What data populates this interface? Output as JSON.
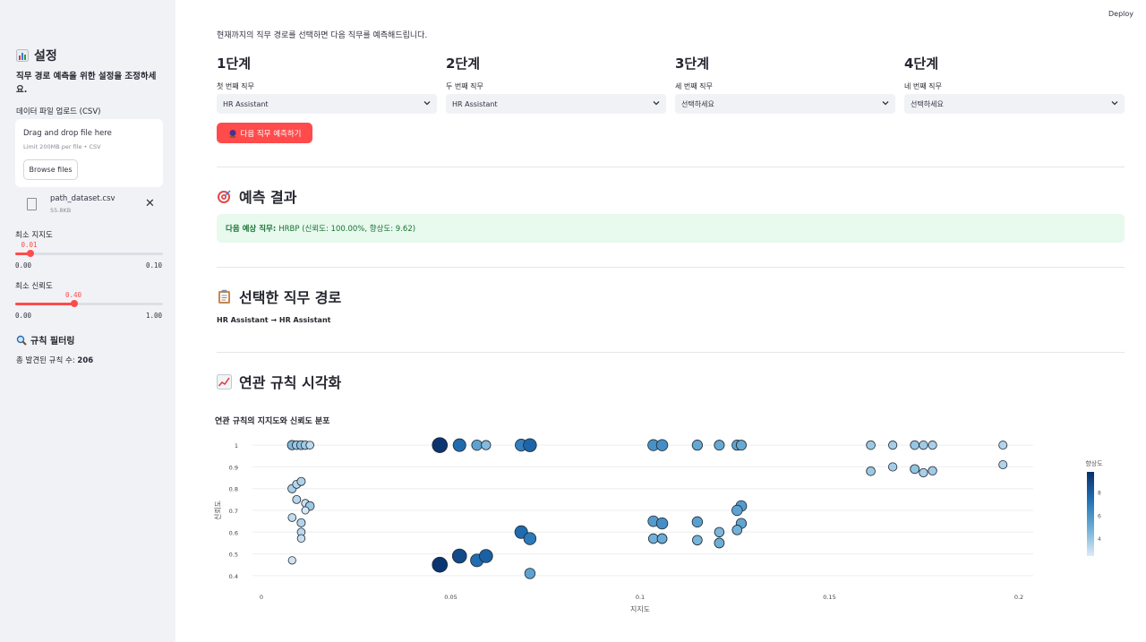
{
  "topbar": {
    "deploy_label": "Deploy"
  },
  "sidebar": {
    "title": "설정",
    "description": "직무 경로 예측을 위한 설정을 조정하세요.",
    "upload": {
      "label": "데이터 파일 업로드 (CSV)",
      "drop_title": "Drag and drop file here",
      "drop_sub": "Limit 200MB per file • CSV",
      "browse_label": "Browse files",
      "file_name": "path_dataset.csv",
      "file_size": "55.8KB"
    },
    "min_support": {
      "label": "최소 지지도",
      "value": "0.01",
      "value_num": 0.01,
      "min": "0.00",
      "max": "0.10",
      "min_num": 0.0,
      "max_num": 0.1
    },
    "min_confidence": {
      "label": "최소 신뢰도",
      "value": "0.40",
      "value_num": 0.4,
      "min": "0.00",
      "max": "1.00",
      "min_num": 0.0,
      "max_num": 1.0
    },
    "filter_title": "규칙 필터링",
    "rule_count_label": "총 발견된 규칙 수:",
    "rule_count": "206"
  },
  "main": {
    "intro": "현재까지의 직무 경로를 선택하면 다음 직무를 예측해드립니다.",
    "steps": [
      {
        "heading": "1단계",
        "label": "첫 번째 직무",
        "value": "HR Assistant"
      },
      {
        "heading": "2단계",
        "label": "두 번째 직무",
        "value": "HR Assistant"
      },
      {
        "heading": "3단계",
        "label": "세 번째 직무",
        "value": "선택하세요"
      },
      {
        "heading": "4단계",
        "label": "네 번째 직무",
        "value": "선택하세요"
      }
    ],
    "predict_button": "다음 직무 예측하기",
    "result_heading": "예측 결과",
    "result_label": "다음 예상 직무:",
    "result_text": "HRBP (신뢰도: 100.00%, 향상도: 9.62)",
    "path_heading": "선택한 직무 경로",
    "path_text": "HR Assistant → HR Assistant",
    "viz_heading": "연관 규칙 시각화"
  },
  "colors": {
    "accent": "#ff4b4b",
    "success_bg": "#e8f9ee",
    "success_text": "#177233",
    "sidebar_bg": "#f0f2f6"
  },
  "chart_data": {
    "type": "scatter",
    "title": "연관 규칙의 지지도와 신뢰도 분포",
    "xlabel": "지지도",
    "ylabel": "신뢰도",
    "colorbar_label": "향상도",
    "xlim": [
      0,
      0.2
    ],
    "ylim": [
      0.35,
      1.05
    ],
    "xticks": [
      0,
      0.05,
      0.1,
      0.15,
      0.2
    ],
    "yticks": [
      0.4,
      0.5,
      0.6,
      0.7,
      0.8,
      0.9,
      1
    ],
    "colorbar_ticks": [
      4,
      6,
      8
    ],
    "colorscale_range": [
      2.5,
      9.8
    ],
    "points": [
      {
        "x": 0.0081,
        "y": 1.0,
        "lift": 4.5
      },
      {
        "x": 0.0093,
        "y": 1.0,
        "lift": 4.0
      },
      {
        "x": 0.0105,
        "y": 1.0,
        "lift": 4.2
      },
      {
        "x": 0.0116,
        "y": 1.0,
        "lift": 3.8
      },
      {
        "x": 0.0128,
        "y": 1.0,
        "lift": 3.2
      },
      {
        "x": 0.0081,
        "y": 0.8,
        "lift": 3.6
      },
      {
        "x": 0.0093,
        "y": 0.82,
        "lift": 3.3
      },
      {
        "x": 0.0105,
        "y": 0.833,
        "lift": 3.5
      },
      {
        "x": 0.0093,
        "y": 0.75,
        "lift": 3.3
      },
      {
        "x": 0.0116,
        "y": 0.733,
        "lift": 3.0
      },
      {
        "x": 0.0128,
        "y": 0.72,
        "lift": 3.9
      },
      {
        "x": 0.0116,
        "y": 0.7,
        "lift": 2.7
      },
      {
        "x": 0.0081,
        "y": 0.667,
        "lift": 3.1
      },
      {
        "x": 0.0105,
        "y": 0.643,
        "lift": 3.4
      },
      {
        "x": 0.0105,
        "y": 0.6,
        "lift": 3.2
      },
      {
        "x": 0.0105,
        "y": 0.571,
        "lift": 3.0
      },
      {
        "x": 0.0081,
        "y": 0.47,
        "lift": 2.8
      },
      {
        "x": 0.0471,
        "y": 1.0,
        "lift": 9.6
      },
      {
        "x": 0.0523,
        "y": 1.0,
        "lift": 7.6
      },
      {
        "x": 0.0569,
        "y": 1.0,
        "lift": 5.4
      },
      {
        "x": 0.0593,
        "y": 1.0,
        "lift": 4.4
      },
      {
        "x": 0.0686,
        "y": 1.0,
        "lift": 6.8
      },
      {
        "x": 0.0709,
        "y": 1.0,
        "lift": 7.8
      },
      {
        "x": 0.0471,
        "y": 0.45,
        "lift": 9.6
      },
      {
        "x": 0.0523,
        "y": 0.49,
        "lift": 8.8
      },
      {
        "x": 0.0569,
        "y": 0.47,
        "lift": 7.5
      },
      {
        "x": 0.0593,
        "y": 0.49,
        "lift": 8.0
      },
      {
        "x": 0.0686,
        "y": 0.6,
        "lift": 7.6
      },
      {
        "x": 0.0709,
        "y": 0.57,
        "lift": 7.0
      },
      {
        "x": 0.0709,
        "y": 0.41,
        "lift": 5.4
      },
      {
        "x": 0.1035,
        "y": 1.0,
        "lift": 6.1
      },
      {
        "x": 0.1058,
        "y": 1.0,
        "lift": 6.2
      },
      {
        "x": 0.1151,
        "y": 1.0,
        "lift": 5.2
      },
      {
        "x": 0.1209,
        "y": 1.0,
        "lift": 5.1
      },
      {
        "x": 0.1256,
        "y": 1.0,
        "lift": 5.3
      },
      {
        "x": 0.1267,
        "y": 1.0,
        "lift": 5.1
      },
      {
        "x": 0.1035,
        "y": 0.65,
        "lift": 5.7
      },
      {
        "x": 0.1058,
        "y": 0.64,
        "lift": 6.2
      },
      {
        "x": 0.1035,
        "y": 0.57,
        "lift": 4.8
      },
      {
        "x": 0.1058,
        "y": 0.57,
        "lift": 5.0
      },
      {
        "x": 0.1151,
        "y": 0.647,
        "lift": 5.5
      },
      {
        "x": 0.1151,
        "y": 0.563,
        "lift": 4.7
      },
      {
        "x": 0.1209,
        "y": 0.6,
        "lift": 4.6
      },
      {
        "x": 0.1209,
        "y": 0.55,
        "lift": 4.9
      },
      {
        "x": 0.1267,
        "y": 0.72,
        "lift": 5.7
      },
      {
        "x": 0.1256,
        "y": 0.7,
        "lift": 5.4
      },
      {
        "x": 0.1267,
        "y": 0.64,
        "lift": 5.3
      },
      {
        "x": 0.1256,
        "y": 0.61,
        "lift": 4.8
      },
      {
        "x": 0.1609,
        "y": 1.0,
        "lift": 3.9
      },
      {
        "x": 0.1667,
        "y": 1.0,
        "lift": 3.7
      },
      {
        "x": 0.1725,
        "y": 1.0,
        "lift": 4.0
      },
      {
        "x": 0.1748,
        "y": 1.0,
        "lift": 3.8
      },
      {
        "x": 0.1772,
        "y": 1.0,
        "lift": 3.6
      },
      {
        "x": 0.1958,
        "y": 1.0,
        "lift": 3.4
      },
      {
        "x": 0.1609,
        "y": 0.88,
        "lift": 3.9
      },
      {
        "x": 0.1667,
        "y": 0.9,
        "lift": 3.7
      },
      {
        "x": 0.1725,
        "y": 0.89,
        "lift": 4.1
      },
      {
        "x": 0.1748,
        "y": 0.873,
        "lift": 3.6
      },
      {
        "x": 0.1772,
        "y": 0.882,
        "lift": 3.8
      },
      {
        "x": 0.1958,
        "y": 0.91,
        "lift": 3.5
      }
    ]
  }
}
